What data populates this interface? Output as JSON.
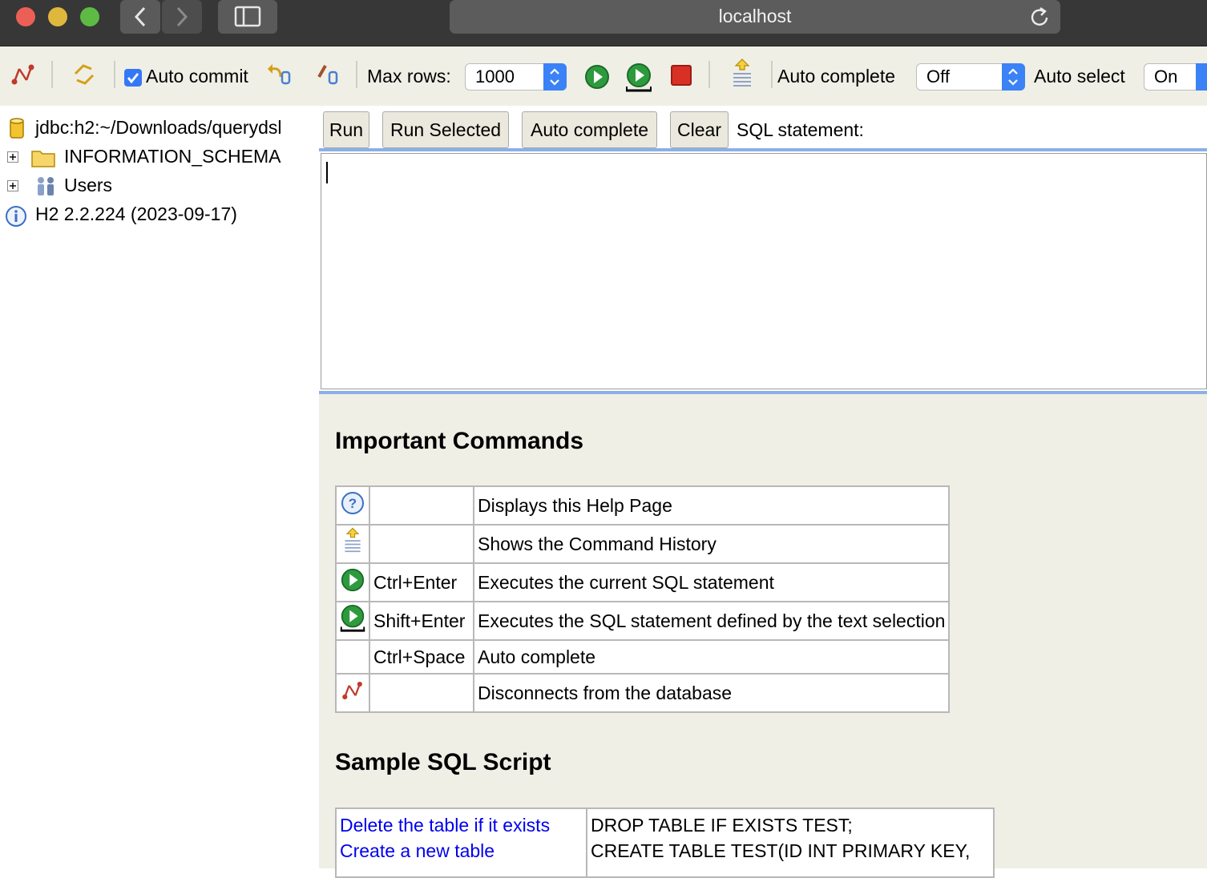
{
  "browser": {
    "address": "localhost"
  },
  "toolbar": {
    "auto_commit_label": "Auto commit",
    "auto_commit_checked": true,
    "max_rows_label": "Max rows:",
    "max_rows_value": "1000",
    "auto_complete_label": "Auto complete",
    "auto_complete_value": "Off",
    "auto_select_label": "Auto select",
    "auto_select_value": "On"
  },
  "tree": {
    "connection": "jdbc:h2:~/Downloads/querydsl",
    "items": [
      {
        "label": "INFORMATION_SCHEMA",
        "icon": "folder-icon"
      },
      {
        "label": "Users",
        "icon": "users-icon"
      }
    ],
    "version": "H2 2.2.224 (2023-09-17)"
  },
  "query_buttons": {
    "run": "Run",
    "run_selected": "Run Selected",
    "auto_complete": "Auto complete",
    "clear": "Clear",
    "sql_label": "SQL statement:"
  },
  "editor": {
    "value": ""
  },
  "help": {
    "important_title": "Important Commands",
    "commands": [
      {
        "icon": "help-icon",
        "shortcut": "",
        "description": "Displays this Help Page"
      },
      {
        "icon": "history-icon",
        "shortcut": "",
        "description": "Shows the Command History"
      },
      {
        "icon": "run-icon",
        "shortcut": "Ctrl+Enter",
        "description": "Executes the current SQL statement"
      },
      {
        "icon": "run-selected-icon",
        "shortcut": "Shift+Enter",
        "description": "Executes the SQL statement defined by the text selection"
      },
      {
        "icon": "",
        "shortcut": "Ctrl+Space",
        "description": "Auto complete"
      },
      {
        "icon": "disconnect-icon",
        "shortcut": "",
        "description": "Disconnects from the database"
      }
    ],
    "sample_title": "Sample SQL Script",
    "sample_links": [
      "Delete the table if it exists",
      "Create a new table"
    ],
    "sample_sql": [
      "DROP TABLE IF EXISTS TEST;",
      "CREATE TABLE TEST(ID INT PRIMARY KEY,"
    ]
  }
}
